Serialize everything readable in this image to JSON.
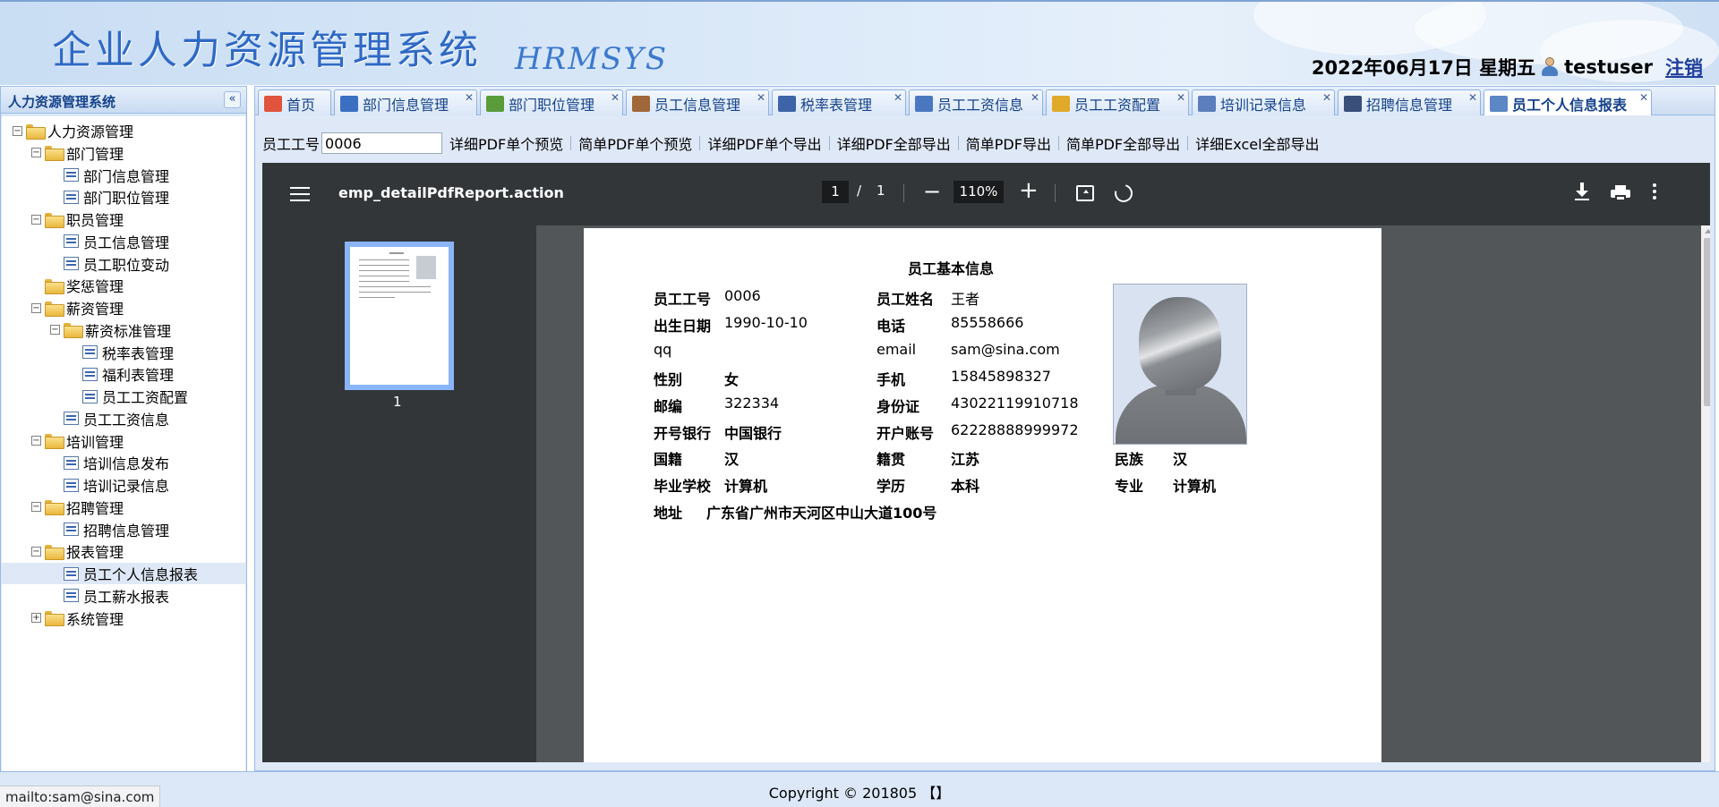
{
  "header": {
    "title": "企业人力资源管理系统",
    "logo_text": "HRMSYS",
    "date": "2022年06月17日 星期五",
    "username": "testuser",
    "logout": "注销"
  },
  "sidebar": {
    "title": "人力资源管理系统",
    "collapse_icon": "«",
    "tree": [
      {
        "label": "人力资源管理",
        "type": "folder",
        "toggle": "⊟",
        "level": 0
      },
      {
        "label": "部门管理",
        "type": "folder",
        "toggle": "⊟",
        "level": 1
      },
      {
        "label": "部门信息管理",
        "type": "leaf",
        "level": 2
      },
      {
        "label": "部门职位管理",
        "type": "leaf",
        "level": 2
      },
      {
        "label": "职员管理",
        "type": "folder",
        "toggle": "⊟",
        "level": 1
      },
      {
        "label": "员工信息管理",
        "type": "leaf",
        "level": 2
      },
      {
        "label": "员工职位变动",
        "type": "leaf",
        "level": 2
      },
      {
        "label": "奖惩管理",
        "type": "folder",
        "level": 1
      },
      {
        "label": "薪资管理",
        "type": "folder",
        "toggle": "⊟",
        "level": 1
      },
      {
        "label": "薪资标准管理",
        "type": "folder",
        "toggle": "⊟",
        "level": 2
      },
      {
        "label": "税率表管理",
        "type": "leaf",
        "level": 3
      },
      {
        "label": "福利表管理",
        "type": "leaf",
        "level": 3
      },
      {
        "label": "员工工资配置",
        "type": "leaf",
        "level": 3
      },
      {
        "label": "员工工资信息",
        "type": "leaf",
        "level": 2
      },
      {
        "label": "培训管理",
        "type": "folder",
        "toggle": "⊟",
        "level": 1
      },
      {
        "label": "培训信息发布",
        "type": "leaf",
        "level": 2
      },
      {
        "label": "培训记录信息",
        "type": "leaf",
        "level": 2
      },
      {
        "label": "招聘管理",
        "type": "folder",
        "toggle": "⊟",
        "level": 1
      },
      {
        "label": "招聘信息管理",
        "type": "leaf",
        "level": 2
      },
      {
        "label": "报表管理",
        "type": "folder",
        "toggle": "⊟",
        "level": 1
      },
      {
        "label": "员工个人信息报表",
        "type": "leaf",
        "level": 2,
        "selected": true
      },
      {
        "label": "员工薪水报表",
        "type": "leaf",
        "level": 2
      },
      {
        "label": "系统管理",
        "type": "folder",
        "toggle": "⊞",
        "level": 1
      }
    ]
  },
  "tabs": [
    {
      "label": "首页",
      "icon": "home-icon",
      "color": "#e0533c",
      "closable": false
    },
    {
      "label": "部门信息管理",
      "icon": "monitor-icon",
      "color": "#3b6fc2",
      "closable": true
    },
    {
      "label": "部门职位管理",
      "icon": "id-card-icon",
      "color": "#5a9b3a",
      "closable": true
    },
    {
      "label": "员工信息管理",
      "icon": "user-icon",
      "color": "#a0673a",
      "closable": true
    },
    {
      "label": "税率表管理",
      "icon": "list-icon",
      "color": "#3d64a8",
      "closable": true
    },
    {
      "label": "员工工资信息",
      "icon": "table-icon",
      "color": "#4a78c0",
      "closable": true
    },
    {
      "label": "员工工资配置",
      "icon": "wallet-icon",
      "color": "#e0a92a",
      "closable": true
    },
    {
      "label": "培训记录信息",
      "icon": "table-icon",
      "color": "#5b7fbd",
      "closable": true
    },
    {
      "label": "招聘信息管理",
      "icon": "bullet-list-icon",
      "color": "#3a4f7a",
      "closable": true
    },
    {
      "label": "员工个人信息报表",
      "icon": "user-report-icon",
      "color": "#5c86c4",
      "closable": true,
      "active": true
    }
  ],
  "tab_close_icon": "✕",
  "toolbar": {
    "emp_id_label": "员工工号",
    "emp_id_value": "0006",
    "buttons": [
      "详细PDF单个预览",
      "简单PDF单个预览",
      "详细PDF单个导出",
      "详细PDF全部导出",
      "简单PDF导出",
      "简单PDF全部导出",
      "详细Excel全部导出"
    ]
  },
  "pdf_viewer": {
    "filename": "emp_detailPdfReport.action",
    "current_page": "1",
    "page_sep": "/",
    "total_pages": "1",
    "zoom": "110%",
    "zoom_out": "−",
    "zoom_in": "+",
    "thumbnail_label": "1"
  },
  "report": {
    "title": "员工基本信息",
    "fields": {
      "emp_id_label": "员工工号",
      "emp_id": "0006",
      "name_label": "员工姓名",
      "name": "王者",
      "birth_label": "出生日期",
      "birth": "1990-10-10",
      "phone_label": "电话",
      "phone": "85558666",
      "qq_label": "qq",
      "qq": "",
      "email_label": "email",
      "email": "sam@sina.com",
      "gender_label": "性别",
      "gender": "女",
      "mobile_label": "手机",
      "mobile": "15845898327",
      "zip_label": "邮编",
      "zip": "322334",
      "idcard_label": "身份证",
      "idcard": "43022119910718",
      "bank_label": "开号银行",
      "bank": "中国银行",
      "account_label": "开户账号",
      "account": "62228888999972",
      "nationality_label": "国籍",
      "nationality": "汉",
      "hometown_label": "籍贯",
      "hometown": "江苏",
      "ethnicity_label": "民族",
      "ethnicity": "汉",
      "school_label": "毕业学校",
      "school": "计算机",
      "degree_label": "学历",
      "degree": "本科",
      "major_label": "专业",
      "major": "计算机",
      "address_label": "地址",
      "address": "广东省广州市天河区中山大道100号"
    }
  },
  "footer": {
    "copyright": "Copyright © 201805 【】",
    "status_url": "mailto:sam@sina.com"
  }
}
